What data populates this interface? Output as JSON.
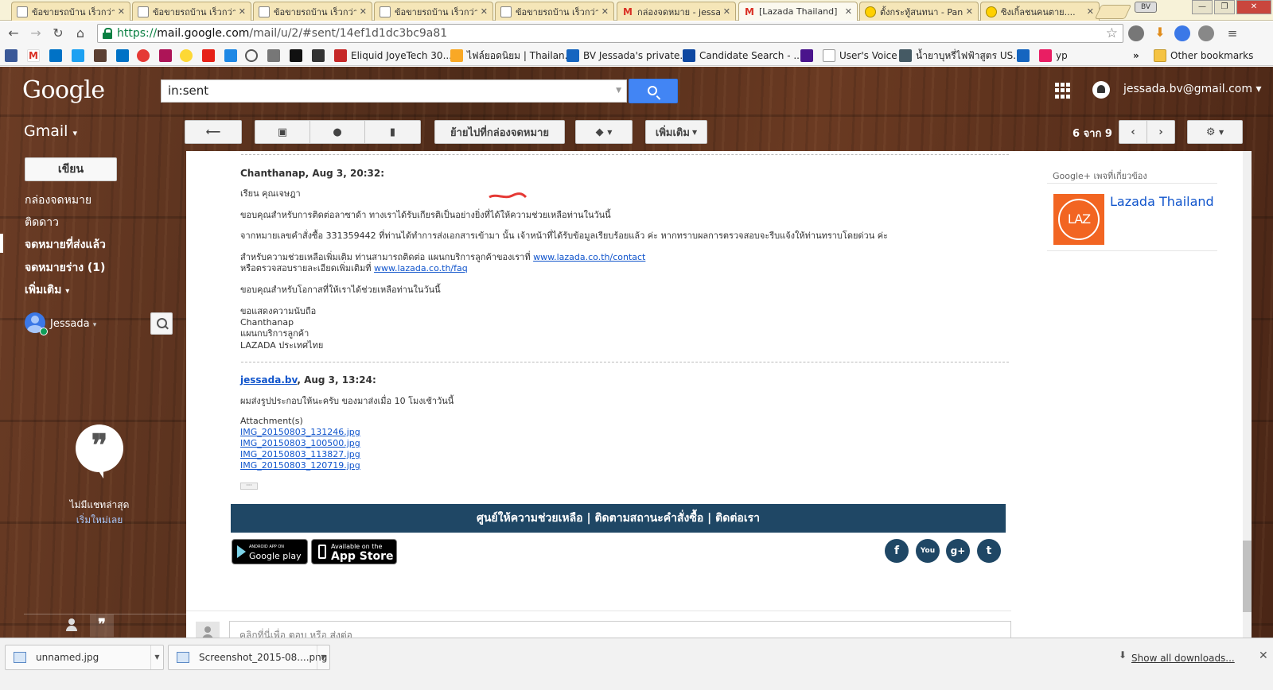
{
  "browser": {
    "tabs": [
      {
        "label": "ข้อขายรถบ้าน เร็วกว่า",
        "icon": "document-icon"
      },
      {
        "label": "ข้อขายรถบ้าน เร็วกว่า",
        "icon": "document-icon"
      },
      {
        "label": "ข้อขายรถบ้าน เร็วกว่า",
        "icon": "document-icon"
      },
      {
        "label": "ข้อขายรถบ้าน เร็วกว่า",
        "icon": "document-icon"
      },
      {
        "label": "ข้อขายรถบ้าน เร็วกว่า",
        "icon": "document-icon"
      },
      {
        "label": "กล่องจดหมาย - jessa",
        "icon": "gmail-icon"
      },
      {
        "label": "[Lazada Thailand]",
        "icon": "gmail-icon"
      },
      {
        "label": "ตั้งกระทู้สนทนา - Pan",
        "icon": "smiley-icon"
      },
      {
        "label": "ซิงเกิ้ลชนคนตาย....",
        "icon": "smiley-icon"
      }
    ],
    "profile_badge": "BV",
    "url": {
      "scheme": "https://",
      "host": "mail.google.com",
      "path": "/mail/u/2/#sent/14ef1d1dc3bc9a81"
    },
    "bookmarks": [
      {
        "label": "Eliquid JoyeTech 30...",
        "color": "#c62828"
      },
      {
        "label": "ไฟล์ยอดนิยม | Thailan...",
        "color": "#f9a825"
      },
      {
        "label": "BV Jessada's private...",
        "color": "#1565c0"
      },
      {
        "label": "Candidate Search - ...",
        "color": "#0d47a1"
      },
      {
        "label": "User's Voice",
        "color": "#9e9e9e"
      },
      {
        "label": "น้ำยาบุหรี่ไฟฟ้าสูตร US...",
        "color": "#455a64"
      },
      {
        "label": "yp",
        "color": "#e91e63"
      }
    ],
    "bookmarks_overflow": "»",
    "other_bookmarks": "Other bookmarks"
  },
  "gmail": {
    "logo": "Google",
    "search_value": "in:sent",
    "account": "jessada.bv@gmail.com",
    "app_label": "Gmail",
    "toolbar": {
      "move_to_inbox": "ย้ายไปที่กล่องจดหมาย",
      "more": "เพิ่มเติม"
    },
    "counter": "6 จาก 9",
    "sidebar": {
      "compose": "เขียน",
      "items": [
        {
          "label": "กล่องจดหมาย"
        },
        {
          "label": "ติดดาว"
        },
        {
          "label": "จดหมายที่ส่งแล้ว"
        },
        {
          "label": "จดหมายร่าง (1)"
        },
        {
          "label": "เพิ่มเติม"
        }
      ],
      "user": "Jessada",
      "no_chats": "ไม่มีแชทล่าสุด",
      "start_new": "เริ่มใหม่เลย"
    },
    "thread": {
      "msg1": {
        "header": "Chanthanap, Aug 3, 20:32:",
        "greeting": "เรียน คุณเจษฎา",
        "p1": "ขอบคุณสำหรับการติดต่อลาซาด้า ทางเราได้รับเกียรติเป็นอย่างยิ่งที่ได้ให้ความช่วยเหลือท่านในวันนี้",
        "p2": "จากหมายเลขคำสั่งซื้อ 331359442 ที่ท่านได้ทำการส่งเอกสารเข้ามา นั้น เจ้าหน้าที่ได้รับข้อมูลเรียบร้อยแล้ว ค่ะ หากทราบผลการตรวจสอบจะรีบแจ้งให้ท่านทราบโดยด่วน ค่ะ",
        "p3_a": "สำหรับความช่วยเหลือเพิ่มเติม ท่านสามารถติดต่อ แผนกบริการลูกค้าของเราที่",
        "p3_link": "www.lazada.co.th/contact",
        "p3_b": "หรือตรวจสอบรายละเอียดเพิ่มเติมที่",
        "p3_link2": "www.lazada.co.th/faq",
        "p4": "ขอบคุณสำหรับโอกาสที่ให้เราได้ช่วยเหลือท่านในวันนี้",
        "sig": [
          "ขอแสดงความนับถือ",
          "Chanthanap",
          "แผนกบริการลูกค้า",
          "LAZADA ประเทศไทย"
        ]
      },
      "msg2": {
        "sender": "jessada.bv",
        "header_rest": ", Aug 3, 13:24:",
        "body": "ผมส่งรูปประกอบให้นะครับ ของมาส่งเมื่อ 10 โมงเช้าวันนี้",
        "attach_label": "Attachment(s)",
        "attachments": [
          "IMG_20150803_131246.jpg",
          "IMG_20150803_100500.jpg",
          "IMG_20150803_113827.jpg",
          "IMG_20150803_120719.jpg"
        ]
      },
      "expander": "···",
      "footer_links": "ศูนย์ให้ความช่วยเหลือ | ติดตามสถานะคำสั่งซื้อ | ติดต่อเรา",
      "google_play": {
        "small": "ANDROID APP ON",
        "big": "Google play"
      },
      "app_store": {
        "small": "Available on the",
        "big": "App Store"
      },
      "social": [
        "f",
        "You",
        "g+",
        "t"
      ],
      "reply_text": "คลิกที่นี่เพื่อ",
      "reply_link": "ตอบ",
      "reply_or": "หรือ",
      "forward_link": "ส่งต่อ"
    },
    "right_panel": {
      "gplus_label": "Google+ เพจที่เกี่ยวข้อง",
      "page_name": "Lazada Thailand",
      "logo_text": "LAZ"
    }
  },
  "downloads": {
    "items": [
      {
        "name": "unnamed.jpg"
      },
      {
        "name": "Screenshot_2015-08....png"
      }
    ],
    "show_all": "Show all downloads..."
  }
}
